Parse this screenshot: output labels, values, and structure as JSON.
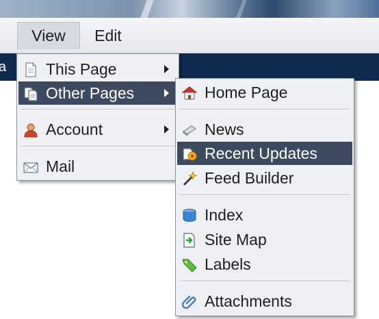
{
  "menubar": {
    "view_label": "View",
    "edit_label": "Edit"
  },
  "navbar": {
    "partial_text": "a"
  },
  "view_menu": {
    "items": [
      {
        "label": "This Page",
        "icon": "page-icon"
      },
      {
        "label": "Other Pages",
        "icon": "pages-icon"
      },
      {
        "label": "Account",
        "icon": "user-icon"
      },
      {
        "label": "Mail",
        "icon": "mail-icon"
      }
    ]
  },
  "other_pages_menu": {
    "items": [
      {
        "label": "Home Page",
        "icon": "home-icon"
      },
      {
        "label": "News",
        "icon": "news-icon"
      },
      {
        "label": "Recent Updates",
        "icon": "recent-updates-icon"
      },
      {
        "label": "Feed Builder",
        "icon": "feed-builder-icon"
      },
      {
        "label": "Index",
        "icon": "index-icon"
      },
      {
        "label": "Site Map",
        "icon": "site-map-icon"
      },
      {
        "label": "Labels",
        "icon": "labels-icon"
      },
      {
        "label": "Attachments",
        "icon": "attachments-icon"
      }
    ]
  },
  "colors": {
    "highlight": "#3d4b60",
    "navbar": "#0e2a4f",
    "menu_bg": "#eef0f3"
  }
}
